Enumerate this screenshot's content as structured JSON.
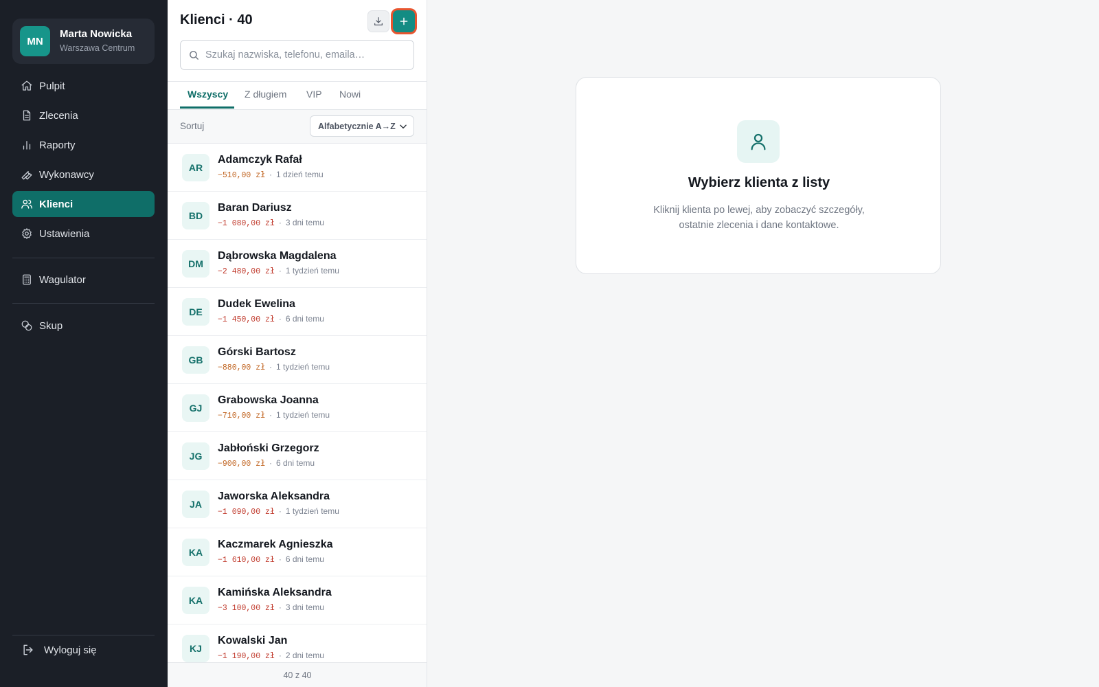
{
  "profile": {
    "initials": "MN",
    "name": "Marta Nowicka",
    "branch": "Warszawa Centrum"
  },
  "nav": {
    "items": [
      {
        "label": "Pulpit",
        "icon": "home-icon"
      },
      {
        "label": "Zlecenia",
        "icon": "document-icon"
      },
      {
        "label": "Raporty",
        "icon": "bar-chart-icon"
      },
      {
        "label": "Wykonawcy",
        "icon": "wrench-icon"
      },
      {
        "label": "Klienci",
        "icon": "users-icon",
        "active": true
      },
      {
        "label": "Ustawienia",
        "icon": "gear-icon"
      }
    ],
    "tools": [
      {
        "label": "Wagulator",
        "icon": "calculator-icon"
      },
      {
        "label": "Skup",
        "icon": "coins-icon"
      }
    ],
    "logout": "Wyloguj się"
  },
  "list": {
    "title": "Klienci · 40",
    "search_placeholder": "Szukaj nazwiska, telefonu, emaila…",
    "tabs": [
      "Wszyscy",
      "Z długiem",
      "VIP",
      "Nowi"
    ],
    "active_tab": "Wszyscy",
    "sort_label": "Sortuj",
    "sort_value": "Alfabetycznie A→Z",
    "clients": [
      {
        "initials": "AR",
        "name": "Adamczyk Rafał",
        "debt": "−510,00 zł",
        "when": "1 dzień temu"
      },
      {
        "initials": "BD",
        "name": "Baran Dariusz",
        "debt": "−1 080,00 zł",
        "when": "3 dni temu"
      },
      {
        "initials": "DM",
        "name": "Dąbrowska Magdalena",
        "debt": "−2 480,00 zł",
        "when": "1 tydzień temu"
      },
      {
        "initials": "DE",
        "name": "Dudek Ewelina",
        "debt": "−1 450,00 zł",
        "when": "6 dni temu"
      },
      {
        "initials": "GB",
        "name": "Górski Bartosz",
        "debt": "−880,00 zł",
        "when": "1 tydzień temu"
      },
      {
        "initials": "GJ",
        "name": "Grabowska Joanna",
        "debt": "−710,00 zł",
        "when": "1 tydzień temu"
      },
      {
        "initials": "JG",
        "name": "Jabłoński Grzegorz",
        "debt": "−900,00 zł",
        "when": "6 dni temu"
      },
      {
        "initials": "JA",
        "name": "Jaworska Aleksandra",
        "debt": "−1 090,00 zł",
        "when": "1 tydzień temu"
      },
      {
        "initials": "KA",
        "name": "Kaczmarek Agnieszka",
        "debt": "−1 610,00 zł",
        "when": "6 dni temu"
      },
      {
        "initials": "KA",
        "name": "Kamińska Aleksandra",
        "debt": "−3 100,00 zł",
        "when": "3 dni temu"
      },
      {
        "initials": "KJ",
        "name": "Kowalski Jan",
        "debt": "−1 190,00 zł",
        "when": "2 dni temu"
      }
    ],
    "footer": "40 z 40"
  },
  "detail": {
    "empty_title": "Wybierz klienta z listy",
    "empty_text": "Kliknij klienta po lewej, aby zobaczyć szczegóły, ostatnie zlecenia i dane kontaktowe."
  },
  "colors": {
    "sidebar": "#1b1f27",
    "accent": "#0f6e68",
    "accent_bright": "#138c83",
    "focus_ring": "#e8552f",
    "debt_red": "#c0392b",
    "debt_orange": "#c0631f"
  }
}
